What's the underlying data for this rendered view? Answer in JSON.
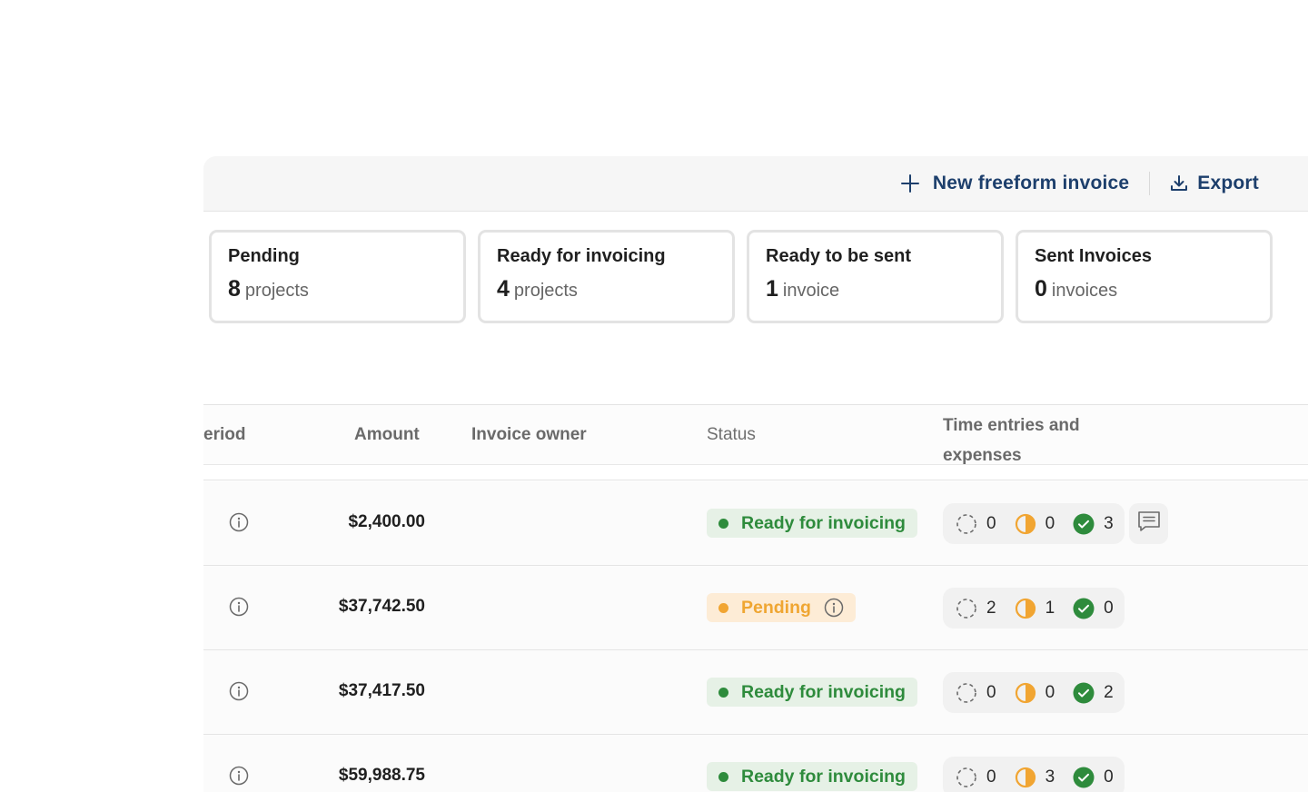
{
  "toolbar": {
    "new_invoice_label": "New freeform invoice",
    "export_label": "Export"
  },
  "cards": [
    {
      "title": "Pending",
      "count": "8",
      "unit": "projects"
    },
    {
      "title": "Ready for invoicing",
      "count": "4",
      "unit": "projects"
    },
    {
      "title": "Ready to be sent",
      "count": "1",
      "unit": "invoice"
    },
    {
      "title": "Sent Invoices",
      "count": "0",
      "unit": "invoices"
    }
  ],
  "table": {
    "headers": {
      "period": "eriod",
      "amount": "Amount",
      "owner": "Invoice owner",
      "status": "Status",
      "entries_line1": "Time entries and",
      "entries_line2": "expenses"
    },
    "rows": [
      {
        "amount": "$2,400.00",
        "status": "Ready for invoicing",
        "status_type": "ready",
        "not_started": "0",
        "in_progress": "0",
        "approved": "3",
        "has_note": true
      },
      {
        "amount": "$37,742.50",
        "status": "Pending",
        "status_type": "pending",
        "not_started": "2",
        "in_progress": "1",
        "approved": "0",
        "has_note": false
      },
      {
        "amount": "$37,417.50",
        "status": "Ready for invoicing",
        "status_type": "ready",
        "not_started": "0",
        "in_progress": "0",
        "approved": "2",
        "has_note": false
      },
      {
        "amount": "$59,988.75",
        "status": "Ready for invoicing",
        "status_type": "ready",
        "not_started": "0",
        "in_progress": "3",
        "approved": "0",
        "has_note": false
      }
    ]
  },
  "colors": {
    "toolbar_text": "#1d3f6c",
    "ready_green": "#2e8b3c",
    "pending_orange": "#f1a532"
  },
  "icons": {
    "new_invoice": "plus-icon",
    "export": "download-icon",
    "row_info": "info-circle-icon",
    "not_started": "dashed-circle-icon",
    "in_progress": "half-circle-icon",
    "approved": "check-circle-icon",
    "note": "comment-icon"
  }
}
